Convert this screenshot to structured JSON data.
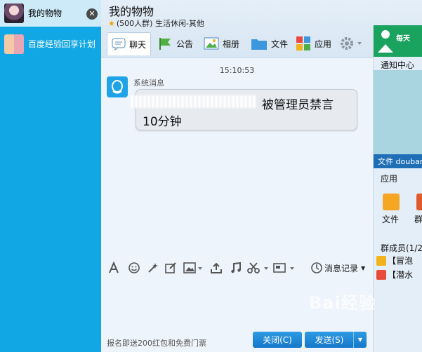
{
  "sidebar": {
    "items": [
      {
        "label": "我的物物",
        "active": true
      },
      {
        "label": "百度经验回享计划",
        "active": false
      }
    ],
    "close_icon": "close-icon"
  },
  "header": {
    "group_name": "我的物物",
    "meta": "(500人群) 生活休闲-其他",
    "tabs": [
      {
        "label": "聊天",
        "icon": "chat-icon"
      },
      {
        "label": "公告",
        "icon": "flag-icon"
      },
      {
        "label": "相册",
        "icon": "photo-icon"
      },
      {
        "label": "文件",
        "icon": "folder-icon"
      },
      {
        "label": "应用",
        "icon": "apps-icon"
      }
    ]
  },
  "chat": {
    "timestamp": "15:10:53",
    "sender": "系统消息",
    "message_line1": "被管理员禁言",
    "message_line2": "10分钟"
  },
  "input_toolbar": {
    "history_label": "消息记录"
  },
  "bottom": {
    "promo": "报名即送200红包和免费门票",
    "close_label": "关闭(C)",
    "send_label": "发送(S)"
  },
  "right_panel": {
    "banner": "每天",
    "notice_title": "通知中心",
    "file_bar": "文件 doubar",
    "apps_title": "应用",
    "app_file": "文件",
    "app_group": "群",
    "members_title": "群成员(1/2",
    "members": [
      "【冒泡",
      "【潜水"
    ]
  },
  "watermark": "Bai经验",
  "colors": {
    "sidebar": "#11a6e4",
    "accent_button": "#1a86d6"
  }
}
